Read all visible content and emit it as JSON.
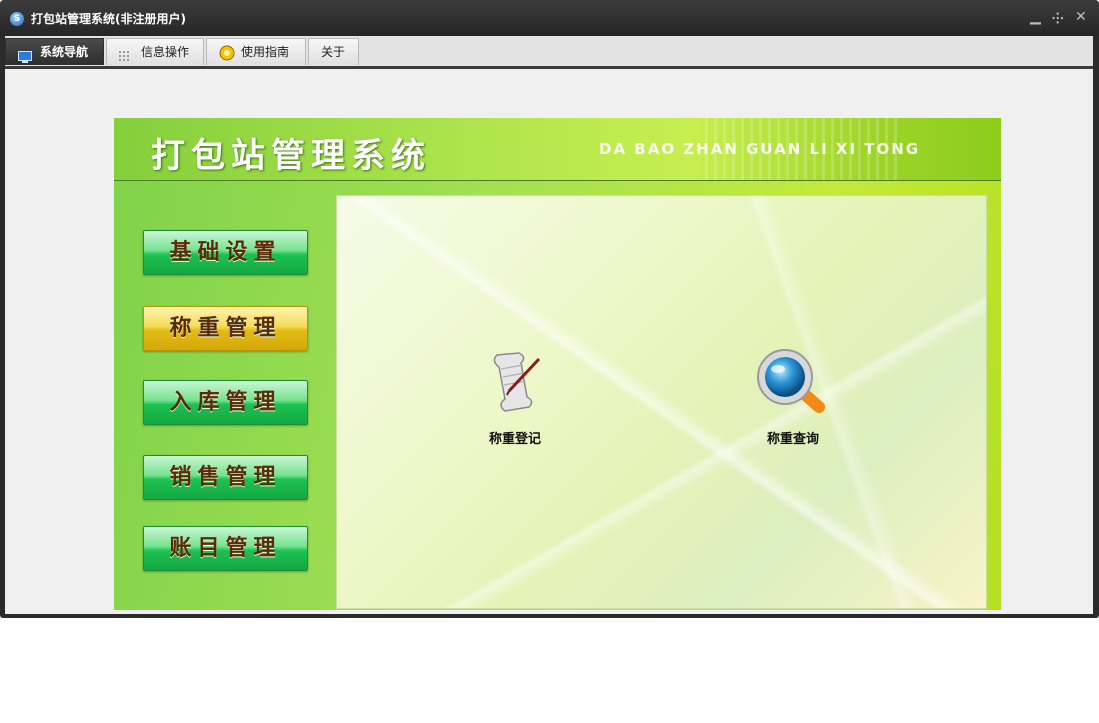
{
  "window": {
    "title": "打包站管理系统(非注册用户)",
    "controls": [
      "minimize",
      "restore",
      "close"
    ]
  },
  "tabs": [
    {
      "label": "系统导航",
      "icon": "monitor-icon",
      "active": true
    },
    {
      "label": "信息操作",
      "icon": "grid-icon",
      "active": false
    },
    {
      "label": "使用指南",
      "icon": "help-icon",
      "active": false
    },
    {
      "label": "关于",
      "icon": "",
      "active": false
    }
  ],
  "banner": {
    "title": "打包站管理系统",
    "subtitle": "DA BAO ZHAN GUAN LI XI TONG"
  },
  "sidebar": {
    "items": [
      {
        "label": "基础设置",
        "active": false
      },
      {
        "label": "称重管理",
        "active": true
      },
      {
        "label": "入库管理",
        "active": false
      },
      {
        "label": "销售管理",
        "active": false
      },
      {
        "label": "账目管理",
        "active": false
      }
    ]
  },
  "features": [
    {
      "label": "称重登记",
      "icon": "scroll-pen-icon"
    },
    {
      "label": "称重查询",
      "icon": "magnifier-icon"
    }
  ],
  "colors": {
    "titlebar": "#2b2b2b",
    "banner_green": "#a3e052",
    "button_green": "#1cc150",
    "button_active_yellow": "#e2bb14"
  }
}
